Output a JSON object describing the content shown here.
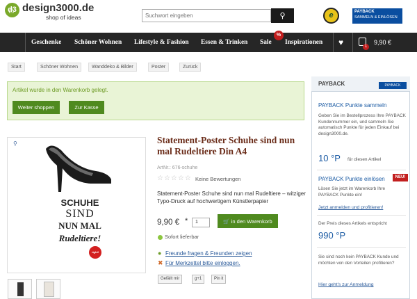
{
  "header": {
    "logo_glyph": "d3",
    "logo_text": "design3000.de",
    "tagline": "shop of ideas",
    "search_placeholder": "Suchwort eingeben",
    "search_icon": "magnifier",
    "trust_badge_letter": "e",
    "payback_label": "PAYBACK",
    "payback_cta": "SAMMELN & EINLÖSEN"
  },
  "nav": {
    "home_icon": "house-icon",
    "items": [
      "Geschenke",
      "Schöner Wohnen",
      "Lifestyle & Fashion",
      "Essen & Trinken",
      "Sale",
      "Inspirationen"
    ],
    "sale_badge": "%",
    "cart_count": "1",
    "cart_total": "9,90 €",
    "wishlist_icon": "heart-icon",
    "cart_icon": "bag-icon"
  },
  "breadcrumb": [
    "Start",
    "Schöner Wohnen",
    "Wanddeko & Bilder",
    "Poster",
    "Zurück"
  ],
  "notice": {
    "text": "Artikel wurde in den Warenkorb gelegt.",
    "continue_label": "Weiter shoppen",
    "checkout_label": "Zur Kasse"
  },
  "product": {
    "title": "Statement-Poster Schuhe sind nun mal Rudeltiere Din A4",
    "artnr": "ArtNr.: 676-schuhe",
    "stars": "☆☆☆☆☆",
    "rating": 0,
    "reviews": "Keine Bewertungen",
    "description": "Statement-Poster Schuhe sind nun mal Rudeltiere – witziger Typo-Druck auf hochwertigem Künstlerpapier",
    "price": "9,90 €",
    "price_note": "*",
    "qty": "1",
    "cart_button": "in den Warenkorb",
    "stock": "Sofort lieferbar",
    "link_friends": "Freunde fragen & Freunden zeigen",
    "link_wishlist": "Für Merkzettel bitte einloggen.",
    "poster_line1": "SCHUHE",
    "poster_line2": "SIND",
    "poster_line3": "NUN MAL",
    "poster_line4": "Rudeltiere!",
    "poster_brand": "right!"
  },
  "social": [
    "Gefällt mir",
    "g+1",
    "Pin it"
  ],
  "sidebar": {
    "title": "PAYBACK",
    "logo": "PAYBACK",
    "collect_heading": "PAYBACK Punkte sammeln",
    "collect_text": "Geben Sie im Bestellprozess Ihre PAYBACK Kundennummer ein, und sammeln Sie automatisch Punkte für jeden Einkauf bei design3000.de.",
    "points_article": "10 °P",
    "points_article_label": "für diesen Artikel",
    "redeem_heading": "PAYBACK Punkte einlösen",
    "new_badge": "NEU!",
    "redeem_text": "Lösen Sie jetzt im Warenkorb Ihre PAYBACK Punkte ein!",
    "login_link": "Jetzt anmelden und profitieren!",
    "price_equiv_text": "Der Preis dieses Artikels entspricht",
    "points_price": "990 °P",
    "noncustomer_text": "Sie sind noch kein PAYBACK Kunde und möchten von den Vorteilen profitieren?",
    "register_link": "Hier geht's zur Anmeldung"
  }
}
